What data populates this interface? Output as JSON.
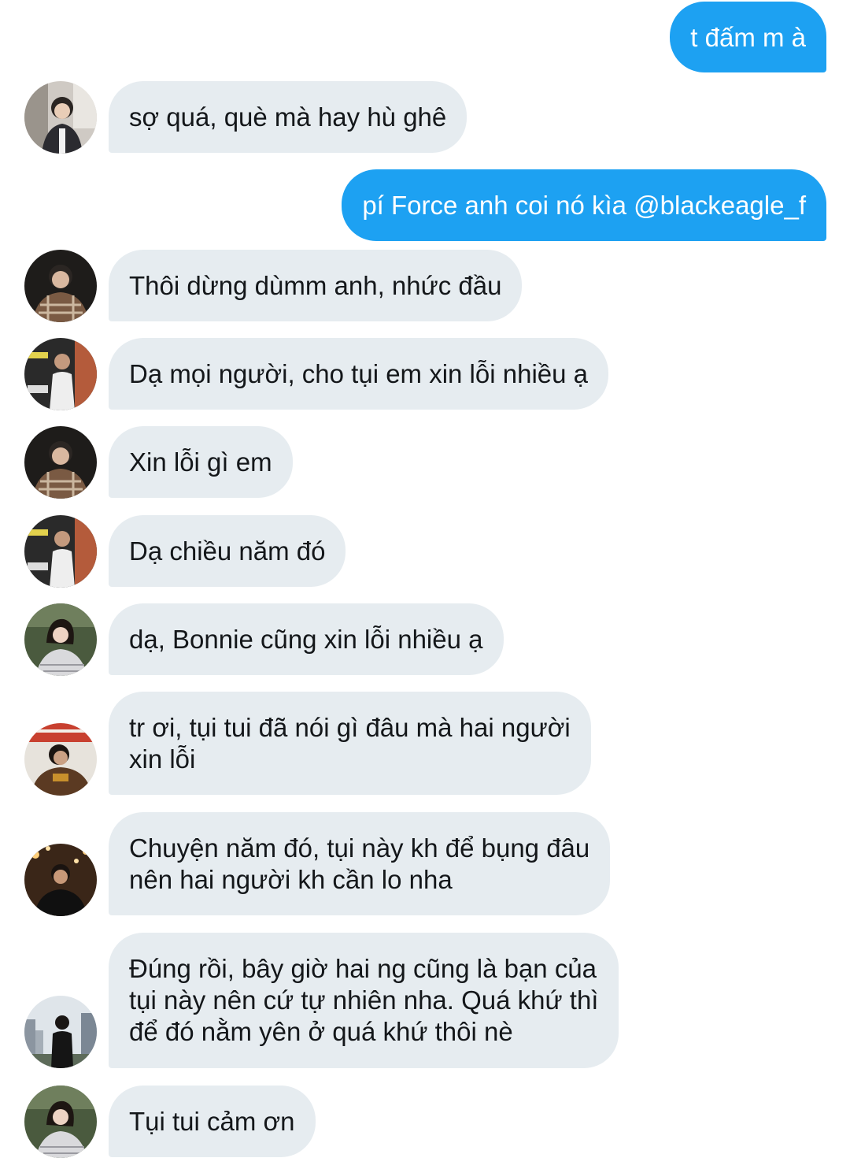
{
  "messages": [
    {
      "from": "me",
      "text": "t đấm m à"
    },
    {
      "from": "other",
      "avatar": "avatar-1-icon",
      "text": "sợ quá, què mà hay hù ghê"
    },
    {
      "from": "me",
      "text": "pí Force anh coi nó kìa @blackeagle_f"
    },
    {
      "from": "other",
      "avatar": "avatar-2-icon",
      "text": "Thôi dừng dùmm anh, nhức đầu"
    },
    {
      "from": "other",
      "avatar": "avatar-3-icon",
      "text": "Dạ mọi người, cho tụi em xin lỗi nhiều ạ"
    },
    {
      "from": "other",
      "avatar": "avatar-2-icon",
      "text": "Xin lỗi gì em"
    },
    {
      "from": "other",
      "avatar": "avatar-3-icon",
      "text": "Dạ chiều năm đó"
    },
    {
      "from": "other",
      "avatar": "avatar-4-icon",
      "text": "dạ, Bonnie cũng xin lỗi nhiều ạ"
    },
    {
      "from": "other",
      "avatar": "avatar-5-icon",
      "text": "tr ơi, tụi tui đã nói gì đâu mà hai người\nxin lỗi"
    },
    {
      "from": "other",
      "avatar": "avatar-6-icon",
      "text": "Chuyện năm đó, tụi này kh để bụng đâu\nnên hai người kh cần lo nha"
    },
    {
      "from": "other",
      "avatar": "avatar-7-icon",
      "text": "Đúng rồi, bây giờ hai ng cũng là bạn của\ntụi này nên cứ tự nhiên nha. Quá khứ thì\nđể đó nằm yên ở quá khứ thôi nè"
    },
    {
      "from": "other",
      "avatar": "avatar-4-icon",
      "text": "Tụi tui cảm ơn"
    }
  ],
  "colors": {
    "outgoing_bubble": "#1da1f2",
    "incoming_bubble": "#e6ecf0",
    "incoming_text": "#14171a",
    "outgoing_text": "#ffffff"
  }
}
